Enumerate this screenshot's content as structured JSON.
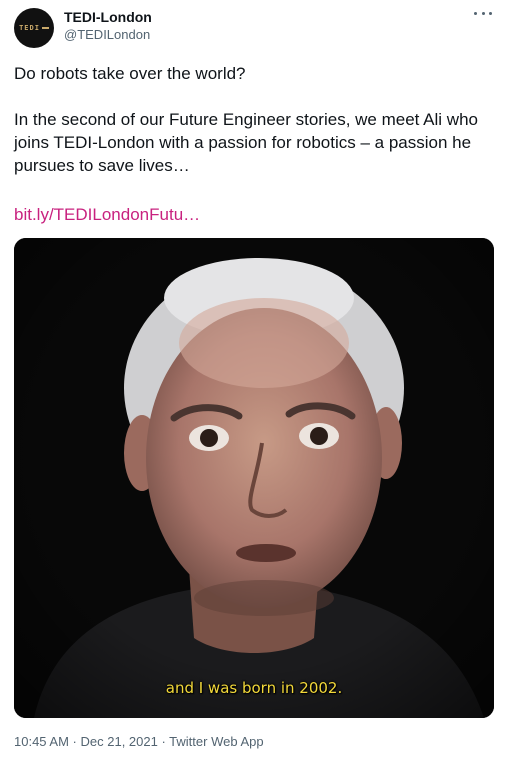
{
  "author": {
    "display_name": "TEDI-London",
    "handle": "@TEDILondon",
    "avatar_logo_text": "TEDI"
  },
  "tweet": {
    "line1": "Do robots take over the world?",
    "line2": "In the second of our Future Engineer stories, we meet Ali who joins TEDI-London with a passion for robotics – a passion he pursues to save lives…",
    "link": "bit.ly/TEDILondonFutu…"
  },
  "media": {
    "subtitle": "and I was born in 2002."
  },
  "meta": {
    "time": "10:45 AM",
    "date": "Dec 21, 2021",
    "source": "Twitter Web App",
    "separator": " · "
  },
  "colors": {
    "link": "#c8227f",
    "subtitle": "#f2d83a",
    "muted": "#536471"
  },
  "icons": {
    "more": "more-options-icon"
  }
}
